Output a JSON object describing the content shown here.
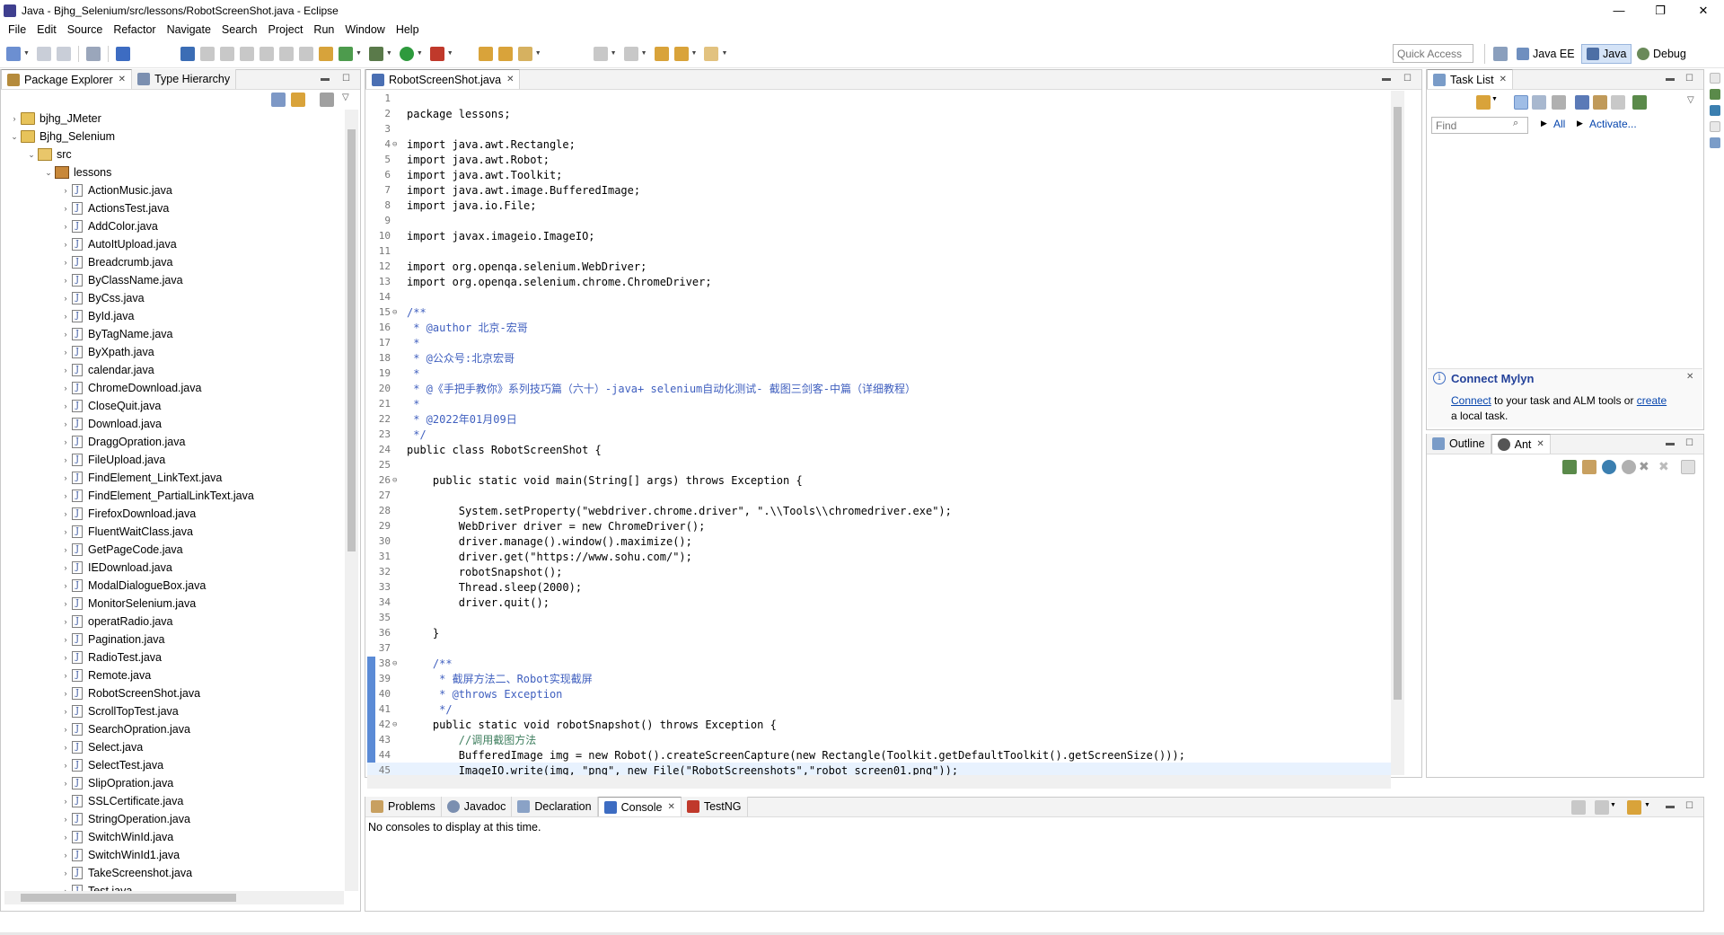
{
  "window": {
    "title": "Java - Bjhg_Selenium/src/lessons/RobotScreenShot.java - Eclipse",
    "minimize_glyph": "—",
    "maximize_glyph": "❐",
    "close_glyph": "✕"
  },
  "menu": [
    "File",
    "Edit",
    "Source",
    "Refactor",
    "Navigate",
    "Search",
    "Project",
    "Run",
    "Window",
    "Help"
  ],
  "toolbar": {
    "quick_access_placeholder": "Quick Access",
    "perspectives": [
      "Java EE",
      "Java",
      "Debug"
    ],
    "active_perspective": "Java"
  },
  "package_explorer": {
    "tabs": [
      "Package Explorer",
      "Type Hierarchy"
    ],
    "tree": [
      {
        "label": "bjhg_JMeter",
        "level": 0,
        "arrow": "›",
        "kind": "proj"
      },
      {
        "label": "Bjhg_Selenium",
        "level": 0,
        "arrow": "⌄",
        "kind": "proj"
      },
      {
        "label": "src",
        "level": 1,
        "arrow": "⌄",
        "kind": "src"
      },
      {
        "label": "lessons",
        "level": 2,
        "arrow": "⌄",
        "kind": "pkg"
      },
      {
        "label": "ActionMusic.java",
        "level": 3,
        "arrow": "›",
        "kind": "java"
      },
      {
        "label": "ActionsTest.java",
        "level": 3,
        "arrow": "›",
        "kind": "java"
      },
      {
        "label": "AddColor.java",
        "level": 3,
        "arrow": "›",
        "kind": "java"
      },
      {
        "label": "AutoItUpload.java",
        "level": 3,
        "arrow": "›",
        "kind": "java"
      },
      {
        "label": "Breadcrumb.java",
        "level": 3,
        "arrow": "›",
        "kind": "java"
      },
      {
        "label": "ByClassName.java",
        "level": 3,
        "arrow": "›",
        "kind": "java"
      },
      {
        "label": "ByCss.java",
        "level": 3,
        "arrow": "›",
        "kind": "java"
      },
      {
        "label": "ById.java",
        "level": 3,
        "arrow": "›",
        "kind": "java"
      },
      {
        "label": "ByTagName.java",
        "level": 3,
        "arrow": "›",
        "kind": "java"
      },
      {
        "label": "ByXpath.java",
        "level": 3,
        "arrow": "›",
        "kind": "java"
      },
      {
        "label": "calendar.java",
        "level": 3,
        "arrow": "›",
        "kind": "java"
      },
      {
        "label": "ChromeDownload.java",
        "level": 3,
        "arrow": "›",
        "kind": "java"
      },
      {
        "label": "CloseQuit.java",
        "level": 3,
        "arrow": "›",
        "kind": "java"
      },
      {
        "label": "Download.java",
        "level": 3,
        "arrow": "›",
        "kind": "java"
      },
      {
        "label": "DraggOpration.java",
        "level": 3,
        "arrow": "›",
        "kind": "java"
      },
      {
        "label": "FileUpload.java",
        "level": 3,
        "arrow": "›",
        "kind": "java"
      },
      {
        "label": "FindElement_LinkText.java",
        "level": 3,
        "arrow": "›",
        "kind": "java"
      },
      {
        "label": "FindElement_PartialLinkText.java",
        "level": 3,
        "arrow": "›",
        "kind": "java"
      },
      {
        "label": "FirefoxDownload.java",
        "level": 3,
        "arrow": "›",
        "kind": "java"
      },
      {
        "label": "FluentWaitClass.java",
        "level": 3,
        "arrow": "›",
        "kind": "java"
      },
      {
        "label": "GetPageCode.java",
        "level": 3,
        "arrow": "›",
        "kind": "java"
      },
      {
        "label": "IEDownload.java",
        "level": 3,
        "arrow": "›",
        "kind": "java"
      },
      {
        "label": "ModalDialogueBox.java",
        "level": 3,
        "arrow": "›",
        "kind": "java"
      },
      {
        "label": "MonitorSelenium.java",
        "level": 3,
        "arrow": "›",
        "kind": "java"
      },
      {
        "label": "operatRadio.java",
        "level": 3,
        "arrow": "›",
        "kind": "java"
      },
      {
        "label": "Pagination.java",
        "level": 3,
        "arrow": "›",
        "kind": "java"
      },
      {
        "label": "RadioTest.java",
        "level": 3,
        "arrow": "›",
        "kind": "java"
      },
      {
        "label": "Remote.java",
        "level": 3,
        "arrow": "›",
        "kind": "java"
      },
      {
        "label": "RobotScreenShot.java",
        "level": 3,
        "arrow": "›",
        "kind": "java"
      },
      {
        "label": "ScrollTopTest.java",
        "level": 3,
        "arrow": "›",
        "kind": "java"
      },
      {
        "label": "SearchOpration.java",
        "level": 3,
        "arrow": "›",
        "kind": "java"
      },
      {
        "label": "Select.java",
        "level": 3,
        "arrow": "›",
        "kind": "java"
      },
      {
        "label": "SelectTest.java",
        "level": 3,
        "arrow": "›",
        "kind": "java"
      },
      {
        "label": "SlipOpration.java",
        "level": 3,
        "arrow": "›",
        "kind": "java"
      },
      {
        "label": "SSLCertificate.java",
        "level": 3,
        "arrow": "›",
        "kind": "java"
      },
      {
        "label": "StringOperation.java",
        "level": 3,
        "arrow": "›",
        "kind": "java"
      },
      {
        "label": "SwitchWinId.java",
        "level": 3,
        "arrow": "›",
        "kind": "java"
      },
      {
        "label": "SwitchWinId1.java",
        "level": 3,
        "arrow": "›",
        "kind": "java"
      },
      {
        "label": "TakeScreenshot.java",
        "level": 3,
        "arrow": "›",
        "kind": "java"
      },
      {
        "label": "Test.java",
        "level": 3,
        "arrow": "›",
        "kind": "java"
      }
    ]
  },
  "editor": {
    "tab": "RobotScreenShot.java",
    "lines": [
      {
        "n": "1",
        "text": "",
        "cls": ""
      },
      {
        "n": "2",
        "text": "package lessons;",
        "cls": ""
      },
      {
        "n": "3",
        "text": "",
        "cls": ""
      },
      {
        "n": "4",
        "fold": "⊖",
        "text": "import java.awt.Rectangle;",
        "cls": ""
      },
      {
        "n": "5",
        "text": "import java.awt.Robot;",
        "cls": ""
      },
      {
        "n": "6",
        "text": "import java.awt.Toolkit;",
        "cls": ""
      },
      {
        "n": "7",
        "text": "import java.awt.image.BufferedImage;",
        "cls": ""
      },
      {
        "n": "8",
        "text": "import java.io.File;",
        "cls": ""
      },
      {
        "n": "9",
        "text": "",
        "cls": ""
      },
      {
        "n": "10",
        "text": "import javax.imageio.ImageIO;",
        "cls": ""
      },
      {
        "n": "11",
        "text": "",
        "cls": ""
      },
      {
        "n": "12",
        "text": "import org.openqa.selenium.WebDriver;",
        "cls": ""
      },
      {
        "n": "13",
        "text": "import org.openqa.selenium.chrome.ChromeDriver;",
        "cls": ""
      },
      {
        "n": "14",
        "text": "",
        "cls": ""
      },
      {
        "n": "15",
        "fold": "⊖",
        "text": "/**",
        "cls": "cm"
      },
      {
        "n": "16",
        "text": " * @author 北京-宏哥",
        "cls": "cm"
      },
      {
        "n": "17",
        "text": " *",
        "cls": "cm"
      },
      {
        "n": "18",
        "text": " * @公众号:北京宏哥",
        "cls": "cm"
      },
      {
        "n": "19",
        "text": " *",
        "cls": "cm"
      },
      {
        "n": "20",
        "text": " * @《手把手教你》系列技巧篇（六十）-java+ selenium自动化测试- 截图三剑客-中篇（详细教程）",
        "cls": "cm"
      },
      {
        "n": "21",
        "text": " *",
        "cls": "cm"
      },
      {
        "n": "22",
        "text": " * @2022年01月09日",
        "cls": "cm"
      },
      {
        "n": "23",
        "text": " */",
        "cls": "cm"
      },
      {
        "n": "24",
        "text": "public class RobotScreenShot {",
        "cls": ""
      },
      {
        "n": "25",
        "text": "",
        "cls": ""
      },
      {
        "n": "26",
        "fold": "⊖",
        "text": "    public static void main(String[] args) throws Exception {",
        "cls": ""
      },
      {
        "n": "27",
        "text": "",
        "cls": ""
      },
      {
        "n": "28",
        "text": "        System.setProperty(\"webdriver.chrome.driver\", \".\\\\Tools\\\\chromedriver.exe\");",
        "cls": ""
      },
      {
        "n": "29",
        "text": "        WebDriver driver = new ChromeDriver();",
        "cls": ""
      },
      {
        "n": "30",
        "text": "        driver.manage().window().maximize();",
        "cls": ""
      },
      {
        "n": "31",
        "text": "        driver.get(\"https://www.sohu.com/\");",
        "cls": ""
      },
      {
        "n": "32",
        "text": "        robotSnapshot();",
        "cls": ""
      },
      {
        "n": "33",
        "text": "        Thread.sleep(2000);",
        "cls": ""
      },
      {
        "n": "34",
        "text": "        driver.quit();",
        "cls": ""
      },
      {
        "n": "35",
        "text": "",
        "cls": ""
      },
      {
        "n": "36",
        "text": "    }",
        "cls": ""
      },
      {
        "n": "37",
        "text": "",
        "cls": ""
      },
      {
        "n": "38",
        "fold": "⊖",
        "text": "    /**",
        "cls": "cm"
      },
      {
        "n": "39",
        "text": "     * 截屏方法二、Robot实现截屏",
        "cls": "cm"
      },
      {
        "n": "40",
        "text": "     * @throws Exception",
        "cls": "cm"
      },
      {
        "n": "41",
        "text": "     */",
        "cls": "cm"
      },
      {
        "n": "42",
        "fold": "⊖",
        "text": "    public static void robotSnapshot() throws Exception {",
        "cls": ""
      },
      {
        "n": "43",
        "text": "        //调用截图方法",
        "cls": "lc"
      },
      {
        "n": "44",
        "text": "        BufferedImage img = new Robot().createScreenCapture(new Rectangle(Toolkit.getDefaultToolkit().getScreenSize()));",
        "cls": ""
      },
      {
        "n": "45",
        "text": "        ImageIO.write(img, \"png\", new File(\"RobotScreenshots\",\"robot_screen01.png\"));",
        "cls": "",
        "current": true
      }
    ]
  },
  "task_list": {
    "tab": "Task List",
    "find_placeholder": "Find",
    "all_label": "All",
    "activate_label": "Activate...",
    "connect_title": "Connect Mylyn",
    "connect_link": "Connect",
    "connect_text": " to your task and ALM tools or ",
    "create_link": "create",
    "connect_text2": "a local task."
  },
  "outline": {
    "tabs": [
      "Outline",
      "Ant"
    ]
  },
  "bottom": {
    "tabs": [
      "Problems",
      "Javadoc",
      "Declaration",
      "Console",
      "TestNG"
    ],
    "active": "Console",
    "message": "No consoles to display at this time."
  }
}
